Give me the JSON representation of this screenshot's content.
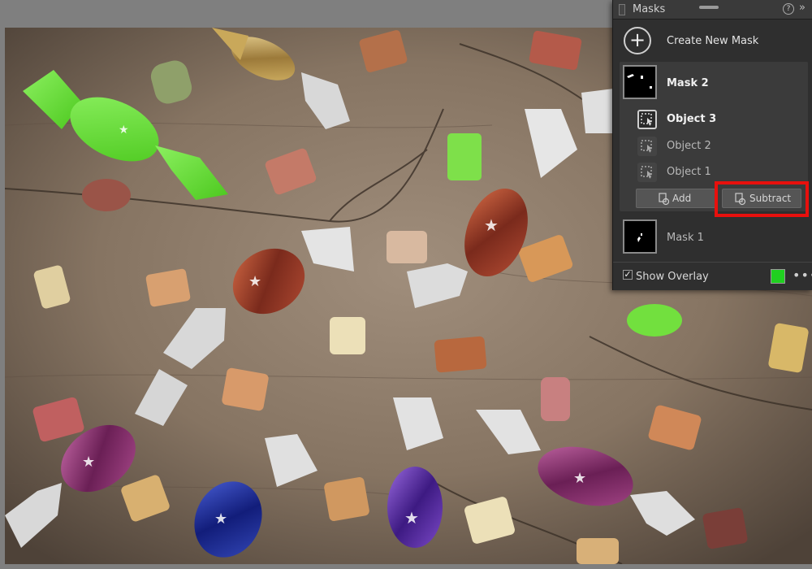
{
  "panel": {
    "title": "Masks",
    "help_icon": "help-icon",
    "expand_icon": "double-chevron-right-icon",
    "create_label": "Create New Mask",
    "masks": [
      {
        "name": "Mask 2",
        "active": true,
        "components": [
          {
            "name": "Object 3",
            "selected": true
          },
          {
            "name": "Object 2",
            "selected": false
          },
          {
            "name": "Object 1",
            "selected": false
          }
        ],
        "add_label": "Add",
        "subtract_label": "Subtract"
      },
      {
        "name": "Mask 1",
        "active": false
      }
    ],
    "show_overlay_label": "Show Overlay",
    "show_overlay_checked": true,
    "overlay_color": "#20d020",
    "more_icon": "more-horizontal-icon"
  },
  "colors": {
    "highlight": "#e8100d",
    "mask_overlay": "#62e03a",
    "panel_bg": "#2f2f2f"
  },
  "photo": {
    "subject": "wrapped-candies-on-wooden-table"
  }
}
